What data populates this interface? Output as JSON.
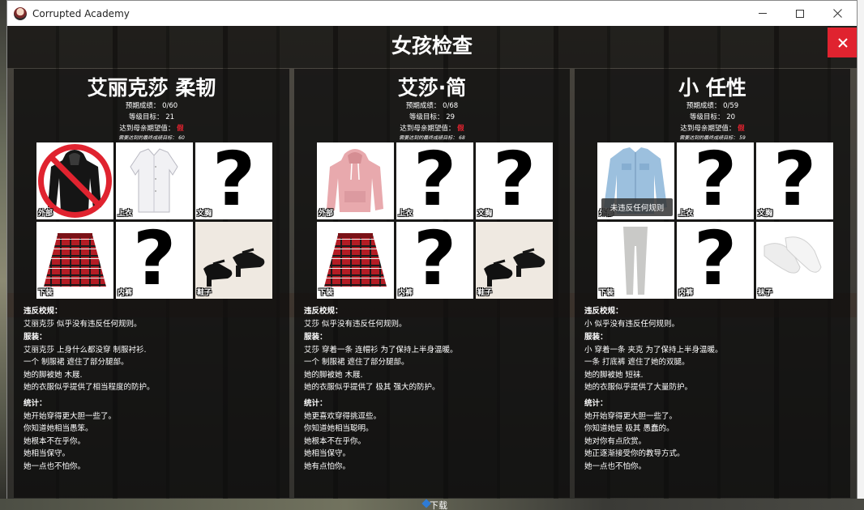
{
  "window": {
    "title": "Corrupted Academy"
  },
  "desktop": {
    "taskbar_download": "下载"
  },
  "header": {
    "title": "女孩检查"
  },
  "panels": [
    {
      "name": "艾丽克莎 柔韧",
      "grade_label": "预期成绩：",
      "grade_value": "0/60",
      "level_label": "等级目标：",
      "level_value": "21",
      "mom_label": "达到母亲期望值：",
      "mom_value": "假",
      "required_label": "需要达到的最终成绩目标：",
      "required_value": "60",
      "slots": [
        {
          "label": "外部",
          "art": "prohibited-hoodie"
        },
        {
          "label": "上衣",
          "art": "white-shirt"
        },
        {
          "label": "文胸",
          "art": "unknown"
        },
        {
          "label": "下装",
          "art": "plaid-skirt"
        },
        {
          "label": "内裤",
          "art": "unknown"
        },
        {
          "label": "鞋子",
          "art": "mary-jane-shoes"
        }
      ],
      "violations_title": "违反校规：",
      "violations": [
        "艾丽克莎 似乎没有违反任何规则。"
      ],
      "outfit_title": "服装：",
      "outfit": [
        "艾丽克莎 上身什么都没穿 制服衬衫.",
        "一个 制服裙 遮住了部分腿部。",
        "她的脚被她 木屐.",
        "她的衣服似乎提供了相当程度的防护。"
      ],
      "stats_title": "统计：",
      "stats": [
        "她开始穿得更大胆一些了。",
        "你知道她相当愚笨。",
        "她根本不在乎你。",
        "她相当保守。",
        "她一点也不怕你。"
      ]
    },
    {
      "name": "艾莎·简",
      "grade_label": "预期成绩：",
      "grade_value": "0/68",
      "level_label": "等级目标：",
      "level_value": "29",
      "mom_label": "达到母亲期望值：",
      "mom_value": "假",
      "required_label": "需要达到的最终成绩目标：",
      "required_value": "68",
      "slots": [
        {
          "label": "外部",
          "art": "pink-hoodie"
        },
        {
          "label": "上衣",
          "art": "unknown"
        },
        {
          "label": "文胸",
          "art": "unknown"
        },
        {
          "label": "下装",
          "art": "plaid-skirt"
        },
        {
          "label": "内裤",
          "art": "unknown"
        },
        {
          "label": "鞋子",
          "art": "mary-jane-shoes"
        }
      ],
      "violations_title": "违反校规：",
      "violations": [
        "艾莎 似乎没有违反任何规则。"
      ],
      "outfit_title": "服装：",
      "outfit": [
        "艾莎 穿着一条 连帽衫 为了保持上半身温暖。",
        "一个 制服裙 遮住了部分腿部。",
        "她的脚被她 木屐.",
        "她的衣服似乎提供了 极其 强大的防护。"
      ],
      "stats_title": "统计：",
      "stats": [
        "她更喜欢穿得挑逗些。",
        "你知道她相当聪明。",
        "她根本不在乎你。",
        "她相当保守。",
        "她有点怕你。"
      ]
    },
    {
      "name": "小 任性",
      "grade_label": "预期成绩：",
      "grade_value": "0/59",
      "level_label": "等级目标：",
      "level_value": "20",
      "mom_label": "达到母亲期望值：",
      "mom_value": "假",
      "required_label": "需要达到的最终成绩目标：",
      "required_value": "59",
      "tooltip": "未违反任何规则",
      "slots": [
        {
          "label": "外部",
          "art": "denim-jacket"
        },
        {
          "label": "上衣",
          "art": "unknown"
        },
        {
          "label": "文胸",
          "art": "unknown"
        },
        {
          "label": "下装",
          "art": "grey-leggings"
        },
        {
          "label": "内裤",
          "art": "unknown"
        },
        {
          "label": "袜子",
          "art": "white-socks"
        }
      ],
      "violations_title": "违反校规：",
      "violations": [
        "小 似乎没有违反任何规则。"
      ],
      "outfit_title": "服装：",
      "outfit": [
        "小 穿着一条 夹克 为了保持上半身温暖。",
        "一条 打底裤 遮住了她的双腿。",
        "她的脚被她 短袜.",
        "她的衣服似乎提供了大量防护。"
      ],
      "stats_title": "统计：",
      "stats": [
        "她开始穿得更大胆一些了。",
        "你知道她是 极其 愚蠢的。",
        "她对你有点欣赏。",
        "她正逐渐接受你的教导方式。",
        "她一点也不怕你。"
      ]
    }
  ],
  "colors": {
    "close_red": "#e0232f",
    "false_red": "#e0232f"
  }
}
